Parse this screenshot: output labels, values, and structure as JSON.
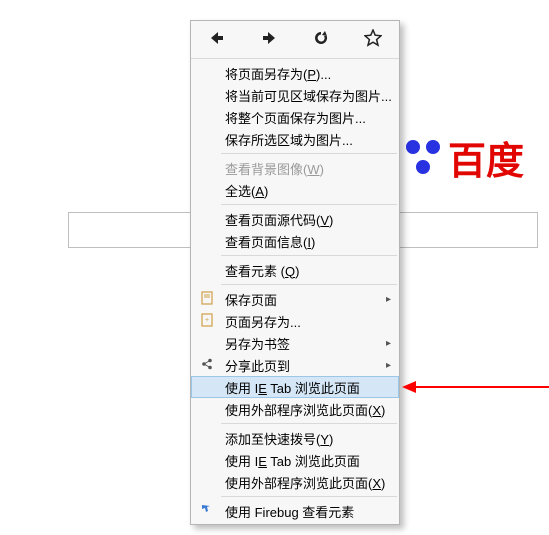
{
  "background": {
    "brand_text": "百度"
  },
  "nav": {
    "back_icon": "back-arrow-icon",
    "forward_icon": "forward-arrow-icon",
    "reload_icon": "reload-icon",
    "star_icon": "star-icon"
  },
  "menu": {
    "items": [
      {
        "label_pre": "将页面另存为(",
        "hotkey": "P",
        "label_post": ")...",
        "interactable": true
      },
      {
        "label_pre": "将当前可见区域保存为图片...",
        "hotkey": "",
        "label_post": "",
        "interactable": true
      },
      {
        "label_pre": "将整个页面保存为图片...",
        "hotkey": "",
        "label_post": "",
        "interactable": true
      },
      {
        "label_pre": "保存所选区域为图片...",
        "hotkey": "",
        "label_post": "",
        "interactable": true
      },
      {
        "type": "sep"
      },
      {
        "label_pre": "查看背景图像(",
        "hotkey": "W",
        "label_post": ")",
        "disabled": true
      },
      {
        "label_pre": "全选(",
        "hotkey": "A",
        "label_post": ")",
        "interactable": true
      },
      {
        "type": "sep"
      },
      {
        "label_pre": "查看页面源代码(",
        "hotkey": "V",
        "label_post": ")",
        "interactable": true
      },
      {
        "label_pre": "查看页面信息(",
        "hotkey": "I",
        "label_post": ")",
        "interactable": true
      },
      {
        "type": "sep"
      },
      {
        "label_pre": "查看元素 (",
        "hotkey": "Q",
        "label_post": ")",
        "interactable": true
      },
      {
        "type": "sep"
      },
      {
        "label_pre": "保存页面",
        "icon": "save-page-icon",
        "submenu": true,
        "interactable": true
      },
      {
        "label_pre": "页面另存为...",
        "icon": "save-as-icon",
        "interactable": true
      },
      {
        "label_pre": "另存为书签",
        "submenu": true,
        "interactable": true
      },
      {
        "label_pre": "分享此页到",
        "icon": "share-icon",
        "submenu": true,
        "interactable": true
      },
      {
        "label_pre": "使用 I",
        "hotkey": "E",
        "label_post": " Tab 浏览此页面",
        "hover": true,
        "interactable": true
      },
      {
        "label_pre": "使用外部程序浏览此页面(",
        "hotkey": "X",
        "label_post": ")",
        "interactable": true
      },
      {
        "type": "sep"
      },
      {
        "label_pre": "添加至快速拨号(",
        "hotkey": "Y",
        "label_post": ")",
        "interactable": true
      },
      {
        "label_pre": "使用 I",
        "hotkey": "E",
        "label_post": " Tab 浏览此页面",
        "interactable": true
      },
      {
        "label_pre": "使用外部程序浏览此页面(",
        "hotkey": "X",
        "label_post": ")",
        "interactable": true
      },
      {
        "type": "sep"
      },
      {
        "label_pre": "使用 Firebug 查看元素",
        "icon": "inspect-icon",
        "interactable": true
      }
    ]
  }
}
